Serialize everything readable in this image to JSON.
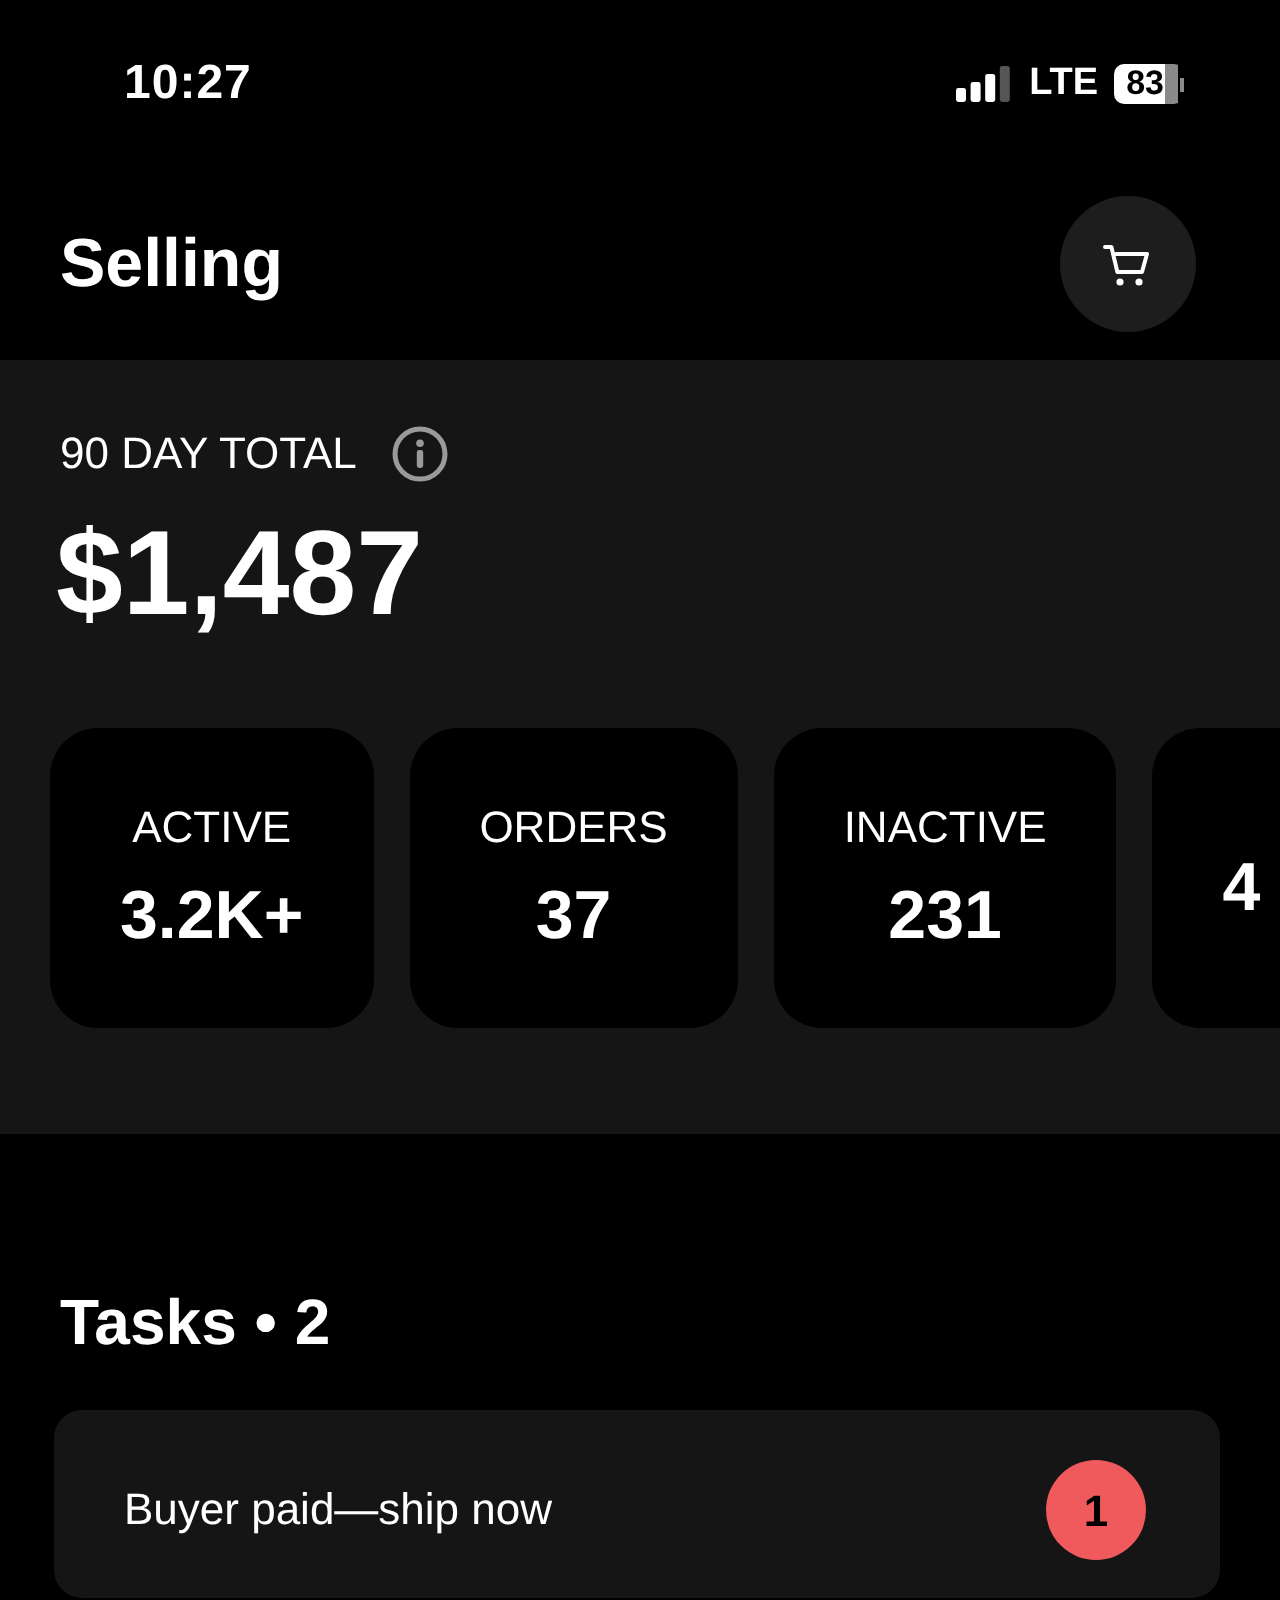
{
  "status_bar": {
    "time": "10:27",
    "network": "LTE",
    "battery": "83"
  },
  "header": {
    "title": "Selling"
  },
  "summary": {
    "label": "90 DAY TOTAL",
    "amount": "$1,487",
    "stats": [
      {
        "label": "ACTIVE",
        "value": "3.2K+"
      },
      {
        "label": "ORDERS",
        "value": "37"
      },
      {
        "label": "INACTIVE",
        "value": "231"
      },
      {
        "value": "4"
      }
    ]
  },
  "tasks": {
    "title": "Tasks • 2",
    "items": [
      {
        "text": "Buyer paid—ship now",
        "count": "1"
      }
    ]
  }
}
